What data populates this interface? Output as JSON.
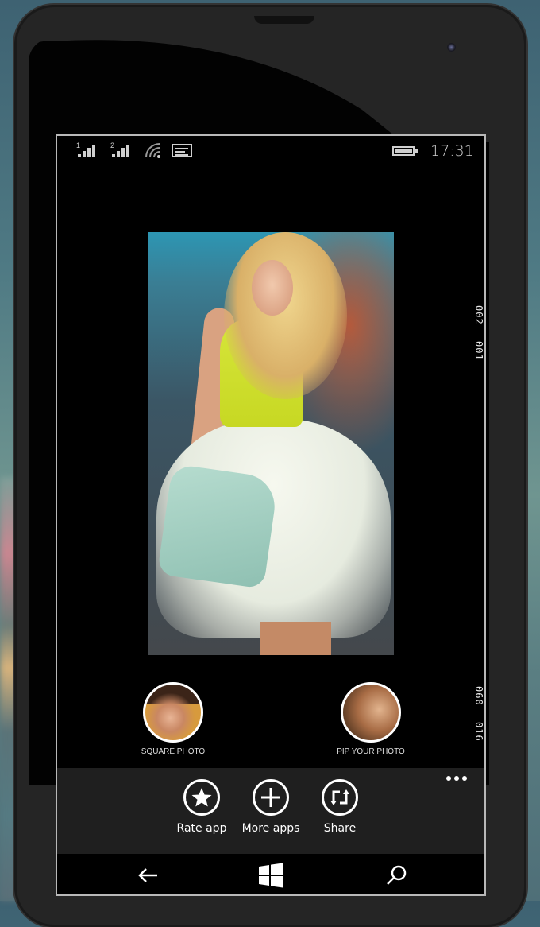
{
  "status_bar": {
    "sim1_label": "1",
    "sim2_label": "2",
    "icons": [
      "signal-sim1-icon",
      "signal-sim2-icon",
      "wifi-icon",
      "message-icon",
      "battery-icon"
    ],
    "time": "17:31"
  },
  "preview": {
    "description": "Photo of a blonde woman in a yellow sleeveless top and white tulle skirt holding a mint quilted bag"
  },
  "side_labels": {
    "top": [
      "002",
      "001"
    ],
    "bottom": [
      "060",
      "016"
    ]
  },
  "features": [
    {
      "label": "SQUARE PHOTO",
      "icon": "square-photo-thumbnail"
    },
    {
      "label": "PIP YOUR PHOTO",
      "icon": "pip-photo-thumbnail"
    }
  ],
  "app_bar": {
    "buttons": [
      {
        "label": "Rate app",
        "icon": "star-icon"
      },
      {
        "label": "More apps",
        "icon": "plus-icon"
      },
      {
        "label": "Share",
        "icon": "share-icon"
      }
    ],
    "more_icon": "ellipsis-icon"
  },
  "nav_bar": {
    "icons": [
      "back-arrow-icon",
      "windows-start-icon",
      "search-icon"
    ]
  }
}
